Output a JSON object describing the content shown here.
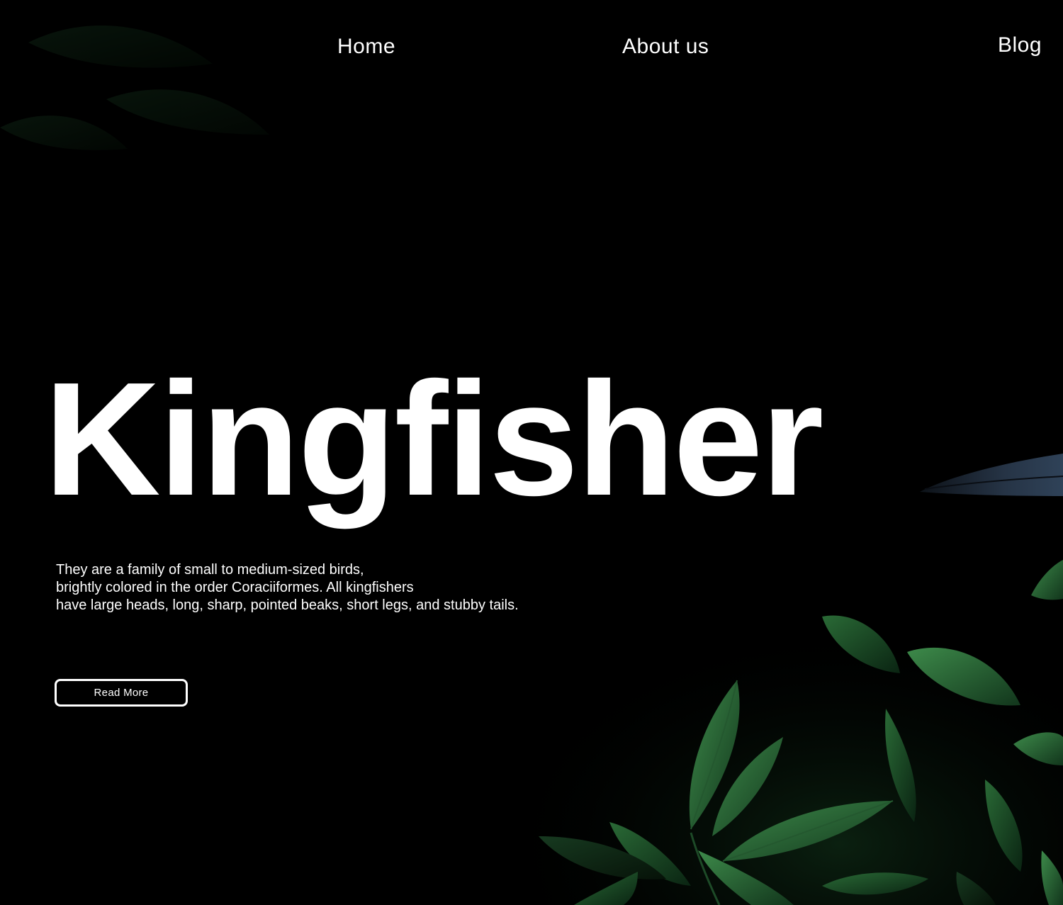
{
  "nav": {
    "items": [
      {
        "label": "Home"
      },
      {
        "label": "About us"
      },
      {
        "label": "Blog"
      }
    ]
  },
  "hero": {
    "title": "Kingfisher",
    "description_lines": [
      "They are a family of small to medium-sized birds,",
      "brightly colored in the order Coraciiformes. All kingfishers",
      "have large heads, long, sharp, pointed beaks, short legs, and stubby tails."
    ],
    "cta_label": "Read More"
  },
  "colors": {
    "background": "#000000",
    "text": "#ffffff",
    "foliage": "#1f5a2c",
    "bird_beak": "#1e2a3a"
  }
}
